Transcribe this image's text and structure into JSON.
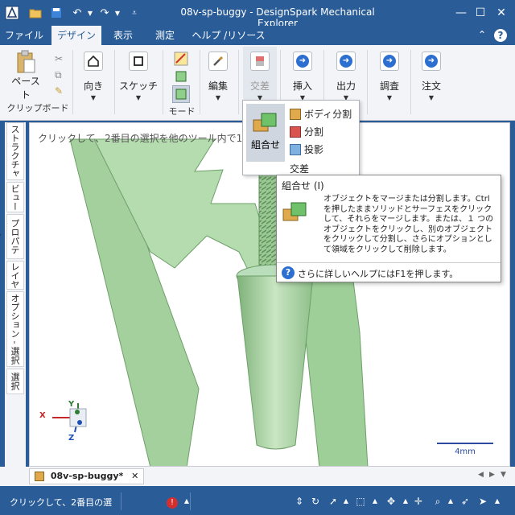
{
  "window": {
    "title": "08v-sp-buggy - DesignSpark Mechanical Explorer",
    "minimize": "—",
    "maximize": "☐",
    "close": "✕"
  },
  "quick_access": [
    "app-logo-icon",
    "open-icon",
    "save-icon",
    "undo-icon",
    "redo-icon",
    "customize-icon"
  ],
  "menu": {
    "tabs": [
      "ファイル",
      "デザイン",
      "表示",
      "測定",
      "ヘルプ /リソース"
    ],
    "active": "デザイン",
    "help_icon": "?"
  },
  "ribbon": {
    "clipboard": {
      "paste": "ペースト",
      "group_label": "クリップボード"
    },
    "orient": "向き",
    "sketch": "スケッチ",
    "mode": "モード",
    "edit": "編集",
    "intersect": "交差",
    "insert": "挿入",
    "output": "出力",
    "investigate": "調査",
    "order": "注文"
  },
  "sidebar": {
    "tabs": [
      "ストラクチャー",
      "ビュー",
      "プロパティ",
      "レイヤ",
      "オプション - 選択",
      "選択"
    ]
  },
  "viewport": {
    "hint": "クリックして、2番目の選択を他のツール内で1",
    "scale_label": "4mm",
    "triad": {
      "x": "X",
      "y": "Y",
      "z": "Z"
    }
  },
  "dropdown": {
    "main_label": "組合せ",
    "items": [
      "ボディ分割",
      "分割",
      "投影"
    ],
    "footer": "交差"
  },
  "tooltip": {
    "title": "組合せ (I)",
    "body": "オブジェクトをマージまたは分割します。Ctrl を押したままソリッドとサーフェスをクリックして、それらをマージします。または、１ つのオブジェクトをクリックし、別のオブジェクトをクリックして分割し、さらにオプションとして領域をクリックして削除します。",
    "help": "さらに詳しいヘルプにはF1を押します。"
  },
  "document_tab": {
    "label": "08v-sp-buggy*",
    "close": "✕",
    "nav": [
      "◀",
      "▶",
      "▼"
    ]
  },
  "status": {
    "message": "クリックして、2番目の選"
  },
  "colors": {
    "titlebar": "#2a5d98",
    "ribbon_bg": "#f2f4f7",
    "model_green": "#a8d5a2",
    "model_green_dark": "#7fb27a",
    "accent_blue": "#2d6fd1"
  }
}
